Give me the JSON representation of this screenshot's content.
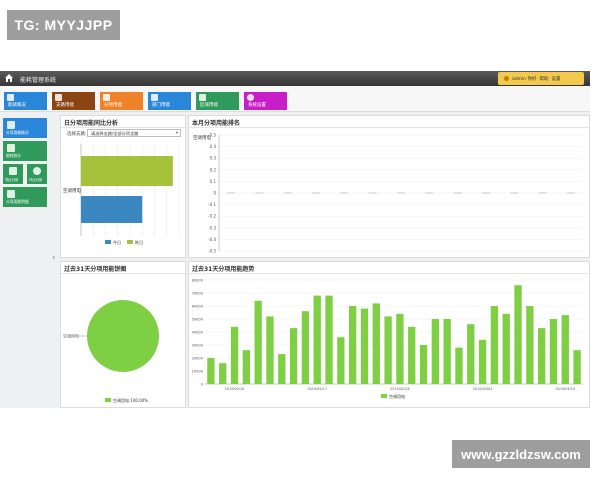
{
  "watermarks": {
    "top_left": "TG: MYYJJPP",
    "bottom_right": "www.gzzldzsw.com"
  },
  "app": {
    "title": "能耗管理系统"
  },
  "user": {
    "greeting": "admin 你好",
    "help": "帮助",
    "settings": "设置"
  },
  "modules": [
    {
      "label": "能耗概况",
      "color": "#2a86d8"
    },
    {
      "label": "支路用能",
      "color": "#8b4513"
    },
    {
      "label": "分项用能",
      "color": "#f0822a"
    },
    {
      "label": "部门用能",
      "color": "#2a86d8"
    },
    {
      "label": "区域用能",
      "color": "#2f9a5a"
    },
    {
      "label": "系统设置",
      "color": "#c81ec8"
    }
  ],
  "sidebar": [
    {
      "label": "分项用能概况",
      "active": true
    },
    {
      "label": "能耗统计"
    },
    {
      "label": "同比分析"
    },
    {
      "label": "环比分析"
    },
    {
      "label": "分项用能明细"
    }
  ],
  "panels": {
    "daily": {
      "title": "日分项用能同比分析",
      "select_label": "选择支路:",
      "select_value": "请选择支路/全部分项支路",
      "chart_data": {
        "type": "bar",
        "orientation": "horizontal",
        "categories": [
          "空调用电"
        ],
        "series": [
          {
            "name": "今日",
            "values": [
              100
            ],
            "color": "#3b87c0"
          },
          {
            "name": "昨日",
            "values": [
              150
            ],
            "color": "#a6c23a"
          }
        ],
        "legend_position": "bottom",
        "grid": true
      }
    },
    "monthly_rank": {
      "title": "本月分项用能排名",
      "chart_data": {
        "type": "bar",
        "ylabel": "空调用电",
        "yticks": [
          "0.5",
          "0.4",
          "0.3",
          "0.2",
          "0.1",
          "0",
          "-0.1",
          "-0.2",
          "-0.3",
          "-0.4",
          "-0.5"
        ],
        "ylim": [
          -0.5,
          0.5
        ],
        "values": [
          0,
          0,
          0,
          0,
          0,
          0,
          0,
          0,
          0,
          0,
          0,
          0,
          0
        ],
        "grid": true
      }
    },
    "pie31": {
      "title": "过去31天分项用能饼图",
      "chart_data": {
        "type": "pie",
        "slices": [
          {
            "name": "空调用电",
            "value": 100,
            "color": "#7fcf45"
          }
        ],
        "callout": "空调用电",
        "legend": "空调用电 100.00%"
      }
    },
    "trend31": {
      "title": "过去31天分项用能趋势",
      "chart_data": {
        "type": "bar",
        "ylim": [
          0,
          80000
        ],
        "yticks": [
          "80000",
          "70000",
          "60000",
          "50000",
          "40000",
          "30000",
          "20000",
          "10000",
          "0"
        ],
        "xtick_labels": [
          "2019/02/10",
          "2019/02/17",
          "2019/02/24",
          "2019/03/03",
          "2019/03/10"
        ],
        "series": [
          {
            "name": "空调用电",
            "color": "#7fcf45",
            "values": [
              20000,
              16000,
              44000,
              26000,
              64000,
              52000,
              23000,
              43000,
              56000,
              68000,
              68000,
              36000,
              60000,
              58000,
              62000,
              52000,
              54000,
              44000,
              30000,
              50000,
              50000,
              28000,
              46000,
              34000,
              60000,
              54000,
              76000,
              60000,
              43000,
              50000,
              53000,
              26000
            ]
          }
        ],
        "legend_position": "bottom",
        "grid": true
      }
    }
  }
}
